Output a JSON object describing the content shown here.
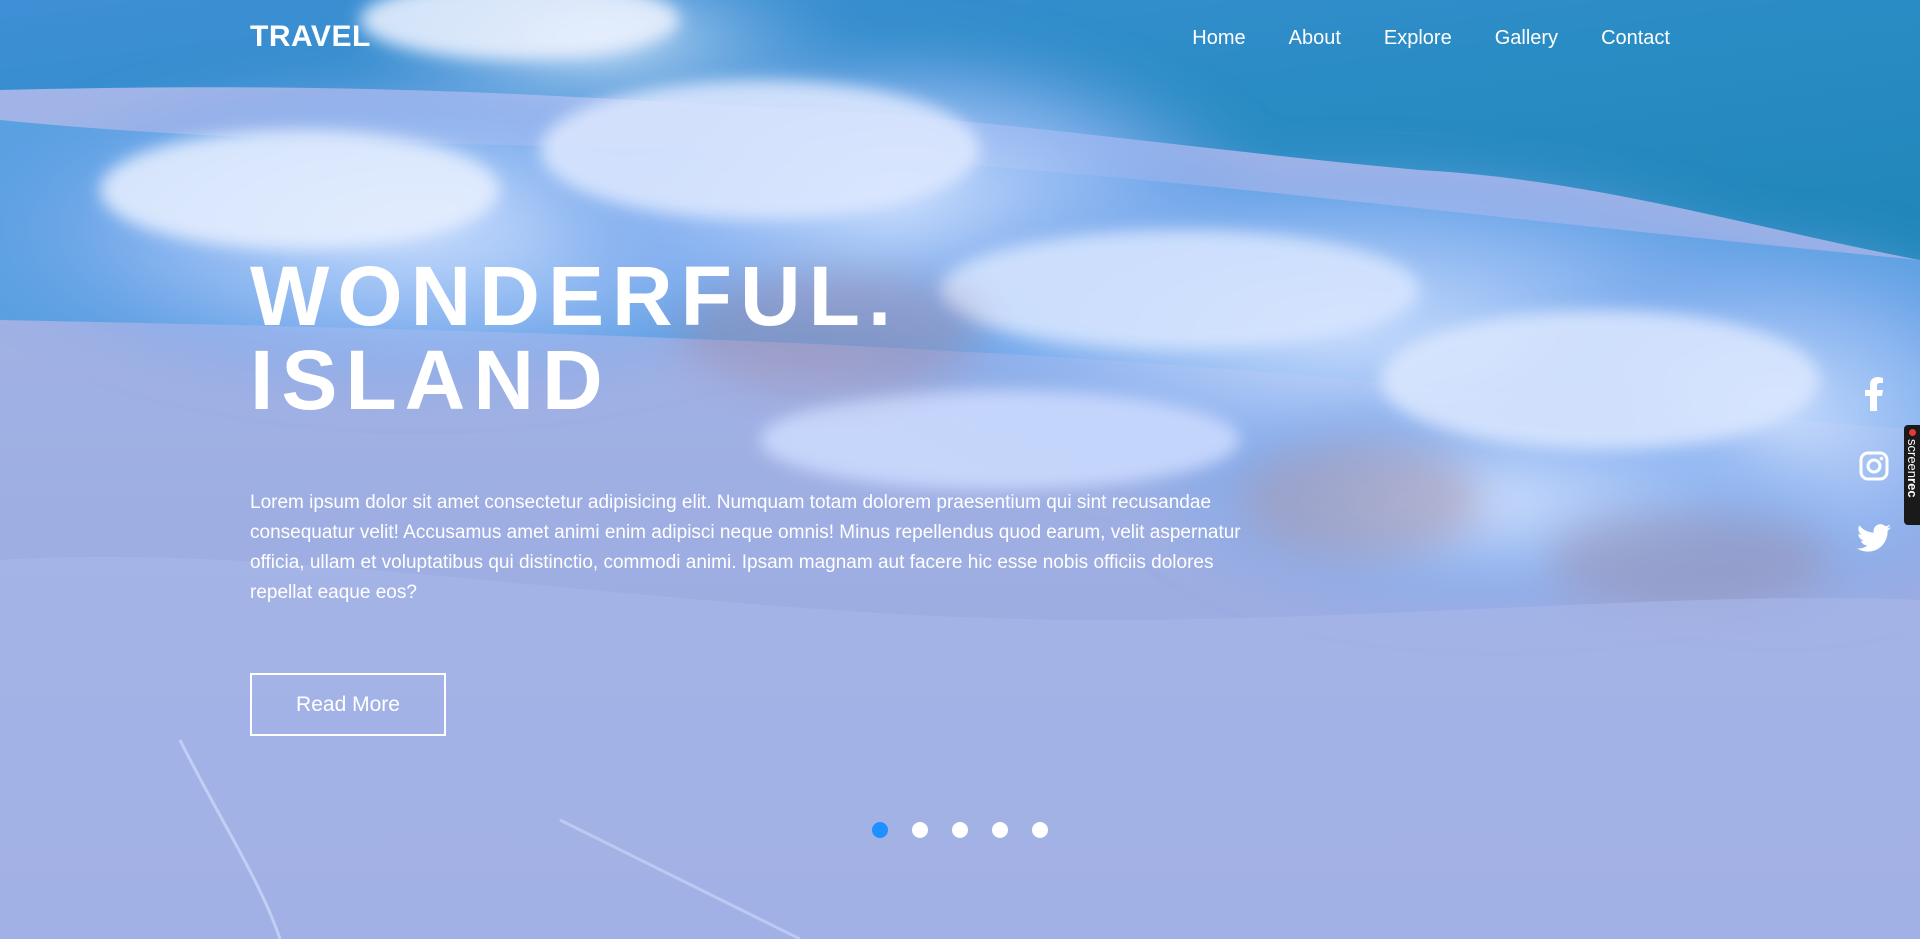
{
  "header": {
    "logo": "TRAVEL",
    "nav": [
      "Home",
      "About",
      "Explore",
      "Gallery",
      "Contact"
    ]
  },
  "hero": {
    "title_line1": "WONDERFUL.",
    "title_line2": "ISLAND",
    "description": "Lorem ipsum dolor sit amet consectetur adipisicing elit. Numquam totam dolorem praesentium qui sint recusandae consequatur velit! Accusamus amet animi enim adipisci neque omnis! Minus repellendus quod earum, velit aspernatur officia, ullam et voluptatibus qui distinctio, commodi animi. Ipsam magnam aut facere hic esse nobis officiis dolores repellat eaque eos?",
    "button_label": "Read More"
  },
  "slider": {
    "total": 5,
    "active_index": 0
  },
  "social": [
    "facebook-icon",
    "instagram-icon",
    "twitter-icon"
  ],
  "recorder_tab": {
    "label_light": "screen",
    "label_bold": "rec"
  },
  "colors": {
    "active_dot": "#1e90ff",
    "text": "#ffffff"
  }
}
